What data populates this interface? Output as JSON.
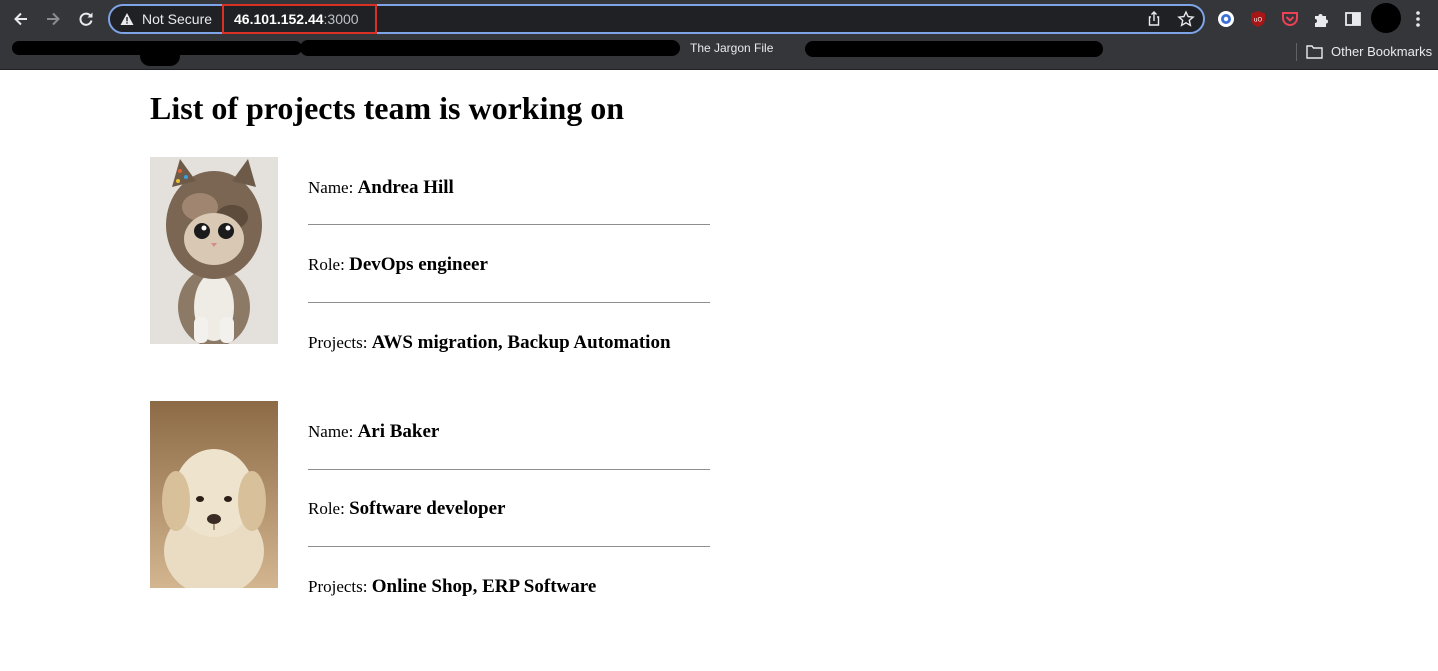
{
  "browser": {
    "security_label": "Not Secure",
    "url_host": "46.101.152.44",
    "url_port": ":3000",
    "bookmarks": {
      "visible_item": "The Jargon File",
      "other_bookmarks": "Other Bookmarks"
    },
    "icons": [
      "back-icon",
      "forward-icon",
      "reload-icon",
      "warning-icon",
      "share-icon",
      "star-icon",
      "extension-icon",
      "puzzle-icon",
      "side-panel-icon",
      "menu-icon",
      "folder-icon"
    ]
  },
  "page": {
    "title": "List of projects team is working on",
    "labels": {
      "name": "Name:",
      "role": "Role:",
      "projects": "Projects:"
    },
    "members": [
      {
        "name": "Andrea Hill",
        "role": "DevOps engineer",
        "projects": "AWS migration, Backup Automation",
        "photo": "kitten"
      },
      {
        "name": "Ari Baker",
        "role": "Software developer",
        "projects": "Online Shop, ERP Software",
        "photo": "puppy"
      }
    ]
  }
}
